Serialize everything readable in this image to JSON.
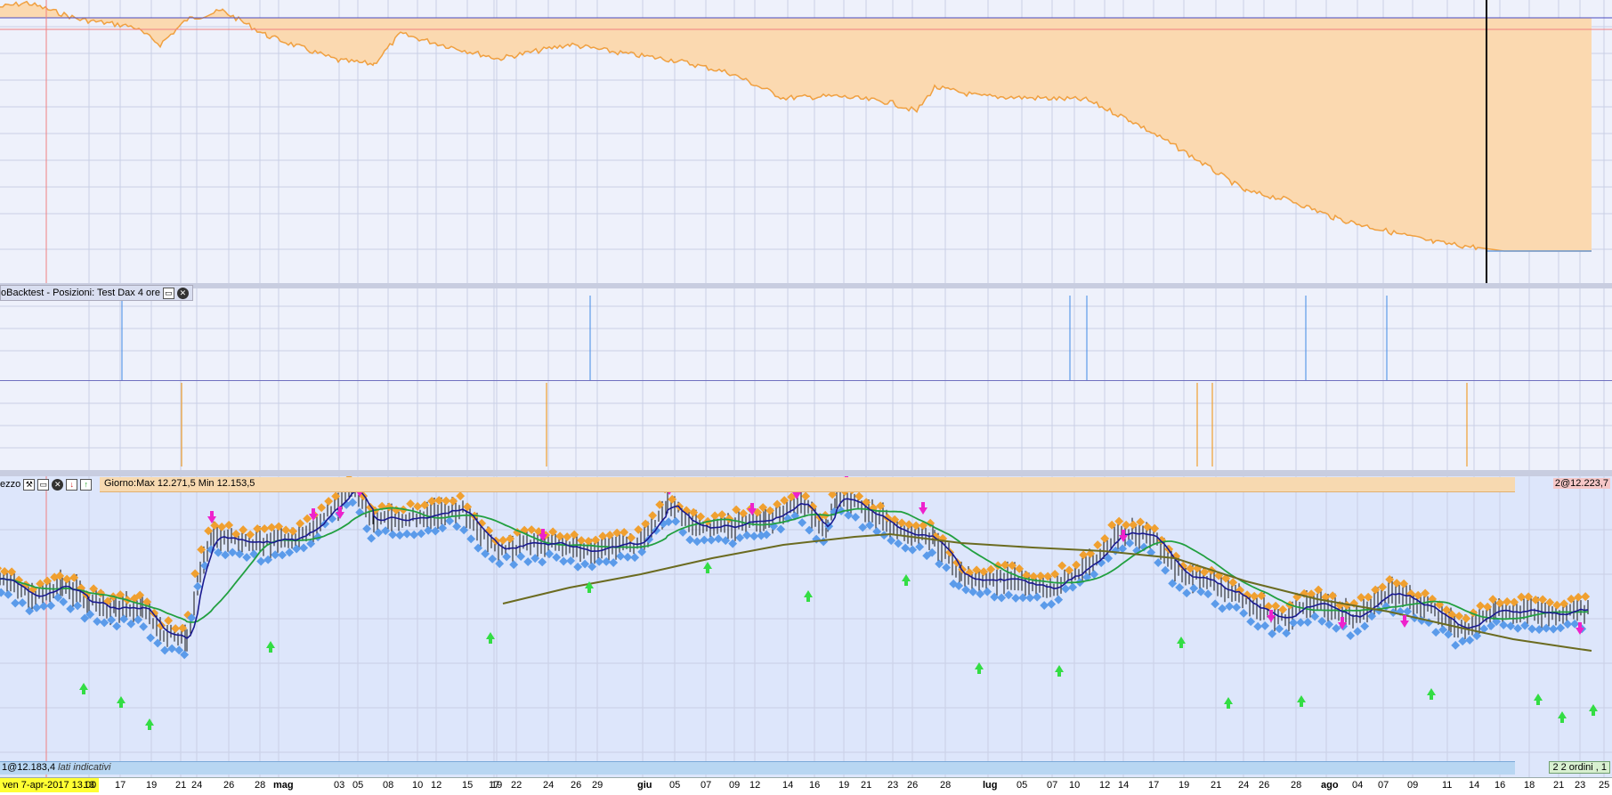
{
  "colors": {
    "equity_fill": "#fbd9b0",
    "equity_line": "#f0a040",
    "equity_line_up": "#6a9ee0",
    "reference_blue": "#4a4ac0",
    "reference_red": "#f08080",
    "long_marker": "#5b9bea",
    "short_marker": "#f0a030",
    "sell_arrow": "#ee22cc",
    "buy_arrow": "#33dd44",
    "ma_short": "#1a1a90",
    "ma_mid": "#22a040",
    "ma_long": "#6b6b20",
    "grid": "#c9cfe6"
  },
  "positions_panel": {
    "title": "oBacktest - Posizioni: Test Dax 4 ore",
    "icons": [
      "window-icon",
      "close-icon"
    ]
  },
  "price_panel": {
    "toolbar_label": "ezzo",
    "icons": [
      "wrench-icon",
      "window-icon",
      "close-icon",
      "move-down-icon",
      "move-up-icon"
    ],
    "header_text": "Giorno:Max 12.271,5 Min 12.153,5",
    "right_label": "2@12.223,7",
    "bottom_left_prefix": "1@12.183,4",
    "bottom_left_note": "lati indicativi",
    "bottom_right_label": "2 2 ordini , 1"
  },
  "time_axis": {
    "current_date": "ven 7-apr-2017 13.00",
    "ticks": [
      {
        "label": "13",
        "month": false
      },
      {
        "label": "17",
        "month": false
      },
      {
        "label": "19",
        "month": false
      },
      {
        "label": "21",
        "month": false
      },
      {
        "label": "24",
        "month": false
      },
      {
        "label": "26",
        "month": false
      },
      {
        "label": "28",
        "month": false
      },
      {
        "label": "mag",
        "month": true
      },
      {
        "label": "03",
        "month": false
      },
      {
        "label": "05",
        "month": false
      },
      {
        "label": "08",
        "month": false
      },
      {
        "label": "10",
        "month": false
      },
      {
        "label": "12",
        "month": false
      },
      {
        "label": "15",
        "month": false
      },
      {
        "label": "17",
        "month": false
      },
      {
        "label": "19",
        "month": false
      },
      {
        "label": "22",
        "month": false
      },
      {
        "label": "24",
        "month": false
      },
      {
        "label": "26",
        "month": false
      },
      {
        "label": "29",
        "month": false
      },
      {
        "label": "giu",
        "month": true
      },
      {
        "label": "05",
        "month": false
      },
      {
        "label": "07",
        "month": false
      },
      {
        "label": "09",
        "month": false
      },
      {
        "label": "12",
        "month": false
      },
      {
        "label": "14",
        "month": false
      },
      {
        "label": "16",
        "month": false
      },
      {
        "label": "19",
        "month": false
      },
      {
        "label": "21",
        "month": false
      },
      {
        "label": "23",
        "month": false
      },
      {
        "label": "26",
        "month": false
      },
      {
        "label": "28",
        "month": false
      },
      {
        "label": "lug",
        "month": true
      },
      {
        "label": "05",
        "month": false
      },
      {
        "label": "07",
        "month": false
      },
      {
        "label": "10",
        "month": false
      },
      {
        "label": "12",
        "month": false
      },
      {
        "label": "14",
        "month": false
      },
      {
        "label": "17",
        "month": false
      },
      {
        "label": "19",
        "month": false
      },
      {
        "label": "21",
        "month": false
      },
      {
        "label": "24",
        "month": false
      },
      {
        "label": "26",
        "month": false
      },
      {
        "label": "28",
        "month": false
      },
      {
        "label": "ago",
        "month": true
      },
      {
        "label": "04",
        "month": false
      },
      {
        "label": "07",
        "month": false
      },
      {
        "label": "09",
        "month": false
      },
      {
        "label": "11",
        "month": false
      },
      {
        "label": "14",
        "month": false
      },
      {
        "label": "16",
        "month": false
      },
      {
        "label": "18",
        "month": false
      },
      {
        "label": "21",
        "month": false
      },
      {
        "label": "23",
        "month": false
      },
      {
        "label": "25",
        "month": false
      }
    ]
  }
}
